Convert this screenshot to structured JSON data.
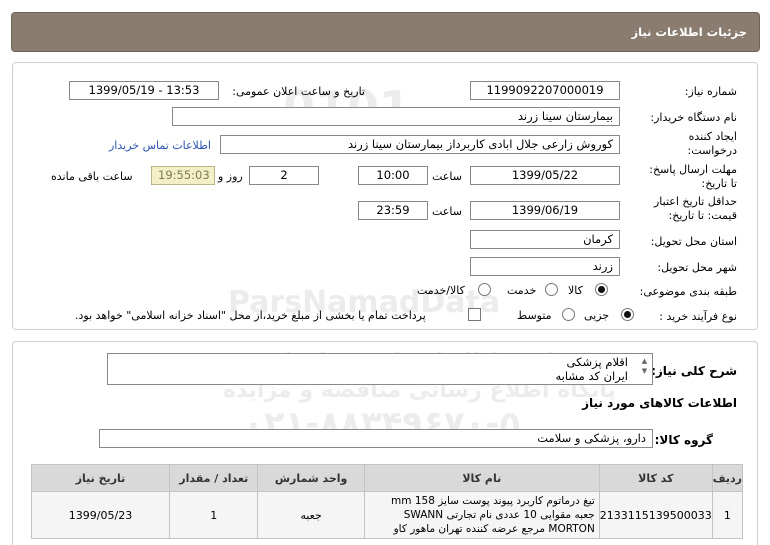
{
  "header": {
    "title": "جزئیات اطلاعات نیاز"
  },
  "fields": {
    "need_number_label": "شماره نیاز:",
    "need_number": "1199092207000019",
    "announce_label": "تاریخ و ساعت اعلان عمومی:",
    "announce_value": "1399/05/19 - 13:53",
    "buyer_org_label": "نام دستگاه خریدار:",
    "buyer_org": "بیمارستان سینا زرند",
    "creator_label_1": "ایجاد کننده",
    "creator_label_2": "درخواست:",
    "creator": "کوروش زارعی جلال ابادی  کاربرداز بیمارستان سینا زرند",
    "contact_link": "اطلاعات تماس خریدار",
    "deadline_label_1": "مهلت ارسال پاسخ:",
    "deadline_label_2": "تا تاریخ:",
    "deadline_date": "1399/05/22",
    "time_label": "ساعت",
    "deadline_time": "10:00",
    "days_value": "2",
    "days_label": "روز و",
    "remaining_time": "19:55:03",
    "remaining_label": "ساعت باقی مانده",
    "validity_label_1": "حداقل تاریخ اعتبار",
    "validity_label_2": "قیمت: تا تاریخ:",
    "validity_date": "1399/06/19",
    "validity_time_label": "ساعت",
    "validity_time": "23:59",
    "province_label": "استان محل تحویل:",
    "province": "کرمان",
    "city_label": "شهر محل تحویل:",
    "city": "زرند",
    "category_label": "طبقه بندی موضوعی:",
    "category_options": [
      "کالا",
      "خدمت",
      "کالا/خدمت"
    ],
    "category_selected": "کالا",
    "process_label": "نوع فرآیند خرید :",
    "process_options": [
      "جزیی",
      "متوسط"
    ],
    "process_selected": "جزیی",
    "payment_note": "پرداخت تمام یا بخشی از مبلغ خرید،از محل \"اسناد خزانه اسلامی\" خواهد بود."
  },
  "description": {
    "label": "شرح کلی نیاز:",
    "lines": [
      "اقلام پزشکی",
      "ایران کد مشابه"
    ]
  },
  "goods": {
    "section_title": "اطلاعات کالاهای مورد نیاز",
    "group_label": "گروه کالا:",
    "group_value": "دارو، پزشکی و سلامت",
    "columns": [
      "ردیف",
      "کد کالا",
      "نام کالا",
      "واحد شمارش",
      "تعداد / مقدار",
      "تاریخ نیاز"
    ],
    "rows": [
      {
        "index": "1",
        "code": "2133115139500033",
        "name": "تیغ درماتوم کاربرد پیوند پوست سایز mm 158 جعبه مقوایی 10 عددی نام تجارتی SWANN MORTON مرجع عرضه کننده تهران ماهور کاو",
        "unit": "جعبه",
        "qty": "1",
        "date": "1399/05/23"
      }
    ]
  },
  "watermark": {
    "brand": "ParsNamadData",
    "line1": "مرکز فراوری اطلاعات پارس نماد داده",
    "line2": "پایگاه اطلاع رسانی مناقصه و مزایده",
    "phone": "۰۲۱-۸۸۳۴۹۶۷۰-۵"
  },
  "colors": {
    "header_bg": "#8a7d6f",
    "link": "#2a55b0",
    "remaining_bg": "#f3f0c7"
  }
}
